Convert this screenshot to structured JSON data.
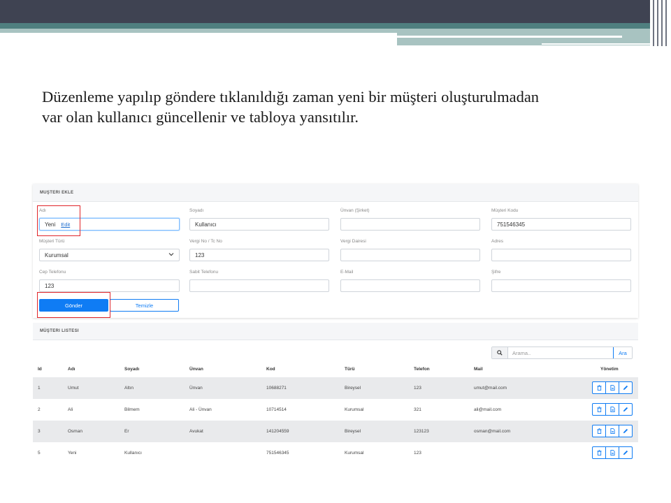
{
  "slide": {
    "text_line1": "Düzenleme yapılıp göndere tıklanıldığı zaman yeni bir müşteri oluşturulmadan",
    "text_line2": "var olan kullanıcı güncellenir ve tabloya yansıtılır."
  },
  "form": {
    "title": "MUŞTERI EKLE",
    "fields": {
      "adi": {
        "label": "Adı",
        "value": "Yeni",
        "link": "Edit"
      },
      "soyadi": {
        "label": "Soyadı",
        "value": "Kullanıcı"
      },
      "unvan": {
        "label": "Ünvan (Şirket)",
        "value": ""
      },
      "musteri_kodu": {
        "label": "Müşteri Kodu",
        "value": "751546345"
      },
      "musteri_turu": {
        "label": "Müşteri Türü",
        "value": "Kurumsal"
      },
      "vergi_no": {
        "label": "Vergi No / Tc No",
        "value": "123"
      },
      "vergi_dairesi": {
        "label": "Vergi Dairesi",
        "value": ""
      },
      "adres": {
        "label": "Adres",
        "value": ""
      },
      "cep_telefonu": {
        "label": "Cep Telefonu",
        "value": "123"
      },
      "sabit_telefonu": {
        "label": "Sabit Telefonu",
        "value": ""
      },
      "email": {
        "label": "E-Mail",
        "value": ""
      },
      "sifre": {
        "label": "Şifre",
        "value": ""
      }
    },
    "submit_label": "Gönder",
    "clear_label": "Temizle"
  },
  "list": {
    "title": "MÜŞTERI LISTESI",
    "search_placeholder": "Arama..",
    "search_button": "Ara",
    "columns": [
      "Id",
      "Adı",
      "Soyadı",
      "Ünvan",
      "Kod",
      "Türü",
      "Telefon",
      "Mail",
      "Yönetim"
    ],
    "rows": [
      {
        "id": "1",
        "adi": "Umut",
        "soyadi": "Altın",
        "unvan": "Ünvan",
        "kod": "10688271",
        "turu": "Bireysel",
        "telefon": "123",
        "mail": "umut@mail.com"
      },
      {
        "id": "2",
        "adi": "Ali",
        "soyadi": "Bilmem",
        "unvan": "Ali - Ünvan",
        "kod": "10714514",
        "turu": "Kurumsal",
        "telefon": "321",
        "mail": "ali@mail.com"
      },
      {
        "id": "3",
        "adi": "Osman",
        "soyadi": "Er",
        "unvan": "Avukat",
        "kod": "141204559",
        "turu": "Bireysel",
        "telefon": "123123",
        "mail": "osman@mail.com"
      },
      {
        "id": "5",
        "adi": "Yeni",
        "soyadi": "Kullanıcı",
        "unvan": "",
        "kod": "751546345",
        "turu": "Kurumsal",
        "telefon": "123",
        "mail": ""
      }
    ]
  },
  "colors": {
    "primary": "#0f7cf4",
    "highlight": "#e0252a",
    "header_band": "#3f4352",
    "teal_band": "#4f7f7f"
  },
  "icons": {
    "search": "search-icon",
    "delete": "trash-icon",
    "detail": "document-icon",
    "edit": "pencil-icon",
    "dropdown": "chevron-down-icon"
  }
}
